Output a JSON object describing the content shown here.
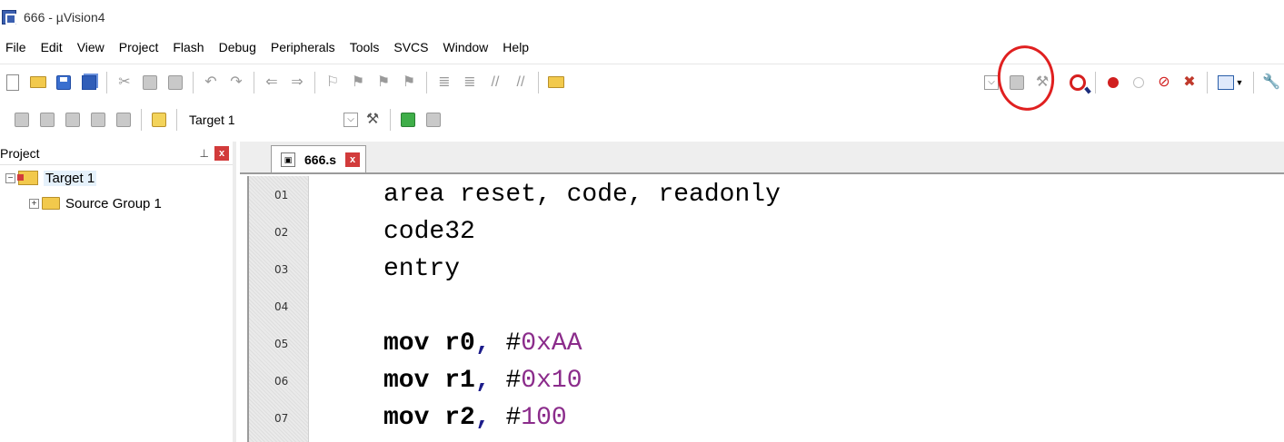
{
  "window": {
    "title": "666  - µVision4"
  },
  "menu": [
    "File",
    "Edit",
    "View",
    "Project",
    "Flash",
    "Debug",
    "Peripherals",
    "Tools",
    "SVCS",
    "Window",
    "Help"
  ],
  "toolbar2": {
    "target_value": "Target 1"
  },
  "project_panel": {
    "header": "Project",
    "tree": [
      {
        "label": "Target 1",
        "level": 0
      },
      {
        "label": "Source Group 1",
        "level": 1
      }
    ]
  },
  "editor": {
    "tab_label": "666.s",
    "lines": [
      {
        "num": "01",
        "text": "area reset, code, readonly"
      },
      {
        "num": "02",
        "text": "code32"
      },
      {
        "num": "03",
        "text": "entry"
      },
      {
        "num": "04",
        "text": ""
      },
      {
        "num": "05",
        "mnemonic": "mov",
        "reg": "r0",
        "sep": ",",
        "hash": "#",
        "imm": "0xAA"
      },
      {
        "num": "06",
        "mnemonic": "mov",
        "reg": "r1",
        "sep": ",",
        "hash": "#",
        "imm": "0x10"
      },
      {
        "num": "07",
        "mnemonic": "mov",
        "reg": "r2",
        "sep": ",",
        "hash": "#",
        "imm": "100"
      }
    ]
  },
  "colors": {
    "annotation": "#e02020",
    "immediate": "#8b2c8b",
    "selection": "#e5f1fb"
  },
  "icons": {
    "toolbar1_left": [
      "new-file-icon",
      "open-folder-icon",
      "save-icon",
      "save-all-icon",
      "cut-icon",
      "copy-icon",
      "paste-icon",
      "undo-icon",
      "redo-icon",
      "nav-back-icon",
      "nav-forward-icon",
      "bookmark-icon",
      "bookmark-prev-icon",
      "bookmark-next-icon",
      "bookmark-clear-icon",
      "indent-icon",
      "unindent-icon",
      "comment-icon",
      "uncomment-icon",
      "find-in-files-icon"
    ],
    "toolbar1_right": [
      "find-dropdown-icon",
      "find-icon",
      "incremental-find-icon",
      "start-debug-icon",
      "insert-breakpoint-icon",
      "enable-breakpoint-icon",
      "disable-breakpoints-icon",
      "kill-breakpoints-icon",
      "window-layout-icon",
      "configure-icon"
    ],
    "toolbar2": [
      "translate-icon",
      "build-icon",
      "rebuild-icon",
      "batch-build-icon",
      "stop-build-icon",
      "download-icon",
      "target-options-icon",
      "manage-components-icon",
      "select-packs-icon"
    ]
  }
}
